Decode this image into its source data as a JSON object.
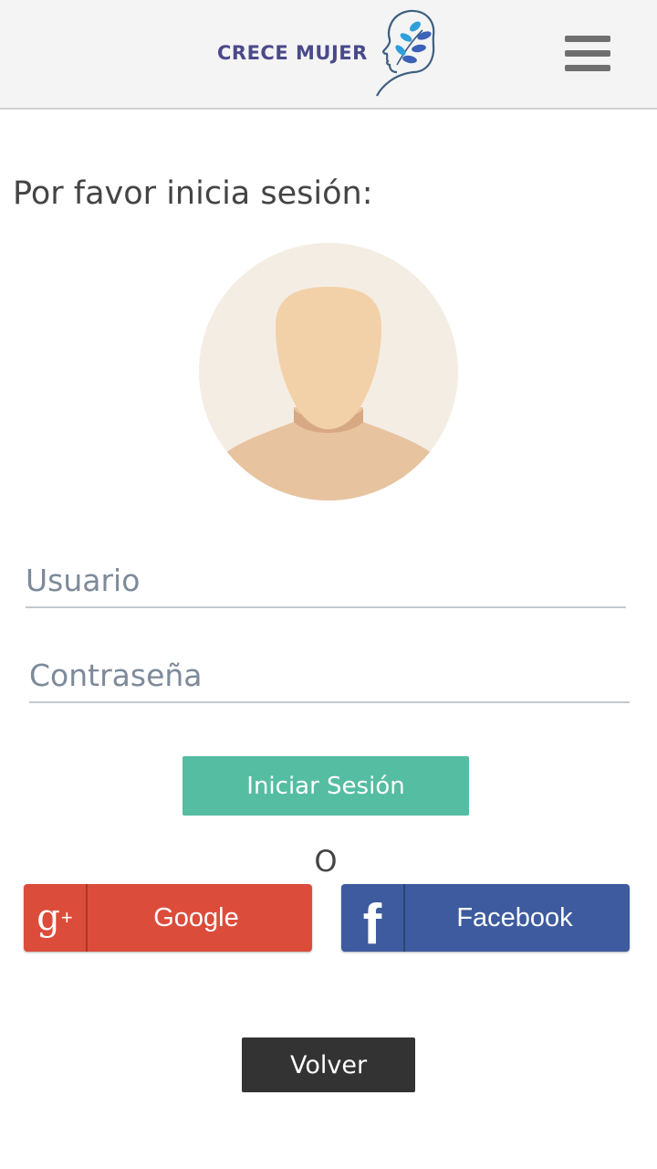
{
  "header": {
    "brand_name": "CRECE MUJER",
    "brand_color": "#4a4a8a",
    "logo_icon": "woman-profile-leaves-icon",
    "menu_icon": "hamburger-menu-icon"
  },
  "login": {
    "prompt": "Por favor inicia sesión:",
    "avatar_icon": "user-avatar-placeholder-icon",
    "username_placeholder": "Usuario",
    "username_value": "",
    "password_placeholder": "Contraseña",
    "password_value": "",
    "submit_label": "Iniciar Sesión",
    "submit_color": "#55bda2",
    "separator": "O",
    "google": {
      "label": "Google",
      "icon": "google-plus-icon",
      "color": "#dc4c3b"
    },
    "facebook": {
      "label": "Facebook",
      "icon": "facebook-icon",
      "color": "#3d5b9e"
    },
    "back_label": "Volver",
    "back_color": "#333333"
  }
}
